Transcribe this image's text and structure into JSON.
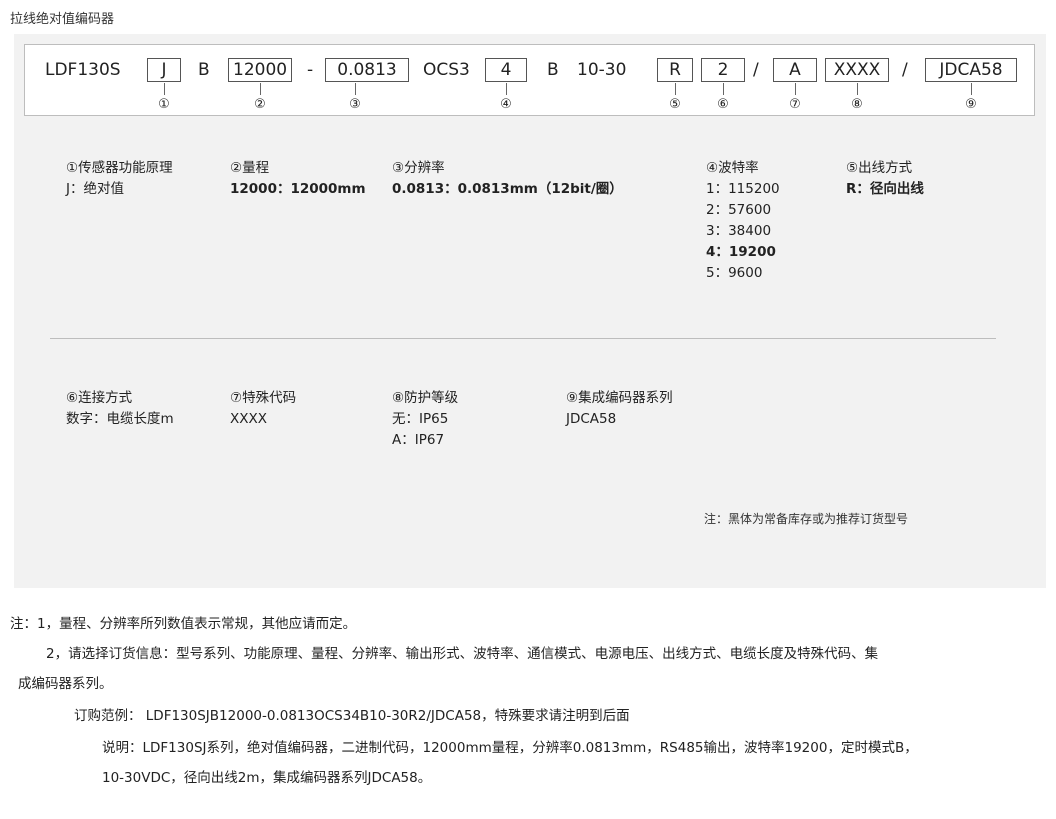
{
  "page_title": "拉线绝对值编码器",
  "model_code": {
    "segments": [
      {
        "text": "LDF130S",
        "boxed": false
      },
      {
        "text": "J",
        "boxed": true
      },
      {
        "text": "B",
        "boxed": false
      },
      {
        "text": "12000",
        "boxed": true
      },
      {
        "text": "-",
        "boxed": false
      },
      {
        "text": "0.0813",
        "boxed": true
      },
      {
        "text": "OCS3",
        "boxed": false
      },
      {
        "text": "4",
        "boxed": true
      },
      {
        "text": "B",
        "boxed": false
      },
      {
        "text": "10-30",
        "boxed": false
      },
      {
        "text": "R",
        "boxed": true
      },
      {
        "text": "2",
        "boxed": true
      },
      {
        "text": "/",
        "boxed": false
      },
      {
        "text": "A",
        "boxed": true
      },
      {
        "text": "XXXX",
        "boxed": true
      },
      {
        "text": "/",
        "boxed": false
      },
      {
        "text": "JDCA58",
        "boxed": true
      }
    ],
    "markers": [
      "①",
      "②",
      "③",
      "④",
      "⑤",
      "⑥",
      "⑦",
      "⑧",
      "⑨"
    ]
  },
  "legend": [
    {
      "title": "①传感器功能原理",
      "options": [
        {
          "text": "J：绝对值",
          "bold": false
        }
      ]
    },
    {
      "title": "②量程",
      "options": [
        {
          "text": "12000：12000mm",
          "bold": true
        }
      ]
    },
    {
      "title": "③分辨率",
      "options": [
        {
          "text": "0.0813：0.0813mm（12bit/圈）",
          "bold": true
        }
      ]
    },
    {
      "title": "④波特率",
      "options": [
        {
          "text": "1：115200",
          "bold": false
        },
        {
          "text": "2：57600",
          "bold": false
        },
        {
          "text": "3：38400",
          "bold": false
        },
        {
          "text": "4：19200",
          "bold": true
        },
        {
          "text": "5：9600",
          "bold": false
        }
      ]
    },
    {
      "title": "⑤出线方式",
      "options": [
        {
          "text": "R：径向出线",
          "bold": true
        }
      ]
    },
    {
      "title": "⑥连接方式",
      "options": [
        {
          "text": "数字：电缆长度m",
          "bold": false
        }
      ]
    },
    {
      "title": "⑦特殊代码",
      "options": [
        {
          "text": "XXXX",
          "bold": false
        }
      ]
    },
    {
      "title": "⑧防护等级",
      "options": [
        {
          "text": "无：IP65",
          "bold": false
        },
        {
          "text": "A：IP67",
          "bold": false
        }
      ]
    },
    {
      "title": "⑨集成编码器系列",
      "options": [
        {
          "text": "JDCA58",
          "bold": false
        }
      ]
    }
  ],
  "stock_note": "注：黑体为常备库存或为推荐订货型号",
  "notes": {
    "note1": "注：1，量程、分辨率所列数值表示常规，其他应请而定。",
    "note2_line1": "2，请选择订货信息：型号系列、功能原理、量程、分辨率、输出形式、波特率、通信模式、电源电压、出线方式、电缆长度及特殊代码、集",
    "note2_line2": "成编码器系列。",
    "example": "订购范例： LDF130SJB12000-0.0813OCS34B10-30R2/JDCA58，特殊要求请注明到后面",
    "explain_line1": "说明：LDF130SJ系列，绝对值编码器，二进制代码，12000mm量程，分辨率0.0813mm，RS485输出，波特率19200，定时模式B，",
    "explain_line2": "10-30VDC，径向出线2m，集成编码器系列JDCA58。"
  }
}
